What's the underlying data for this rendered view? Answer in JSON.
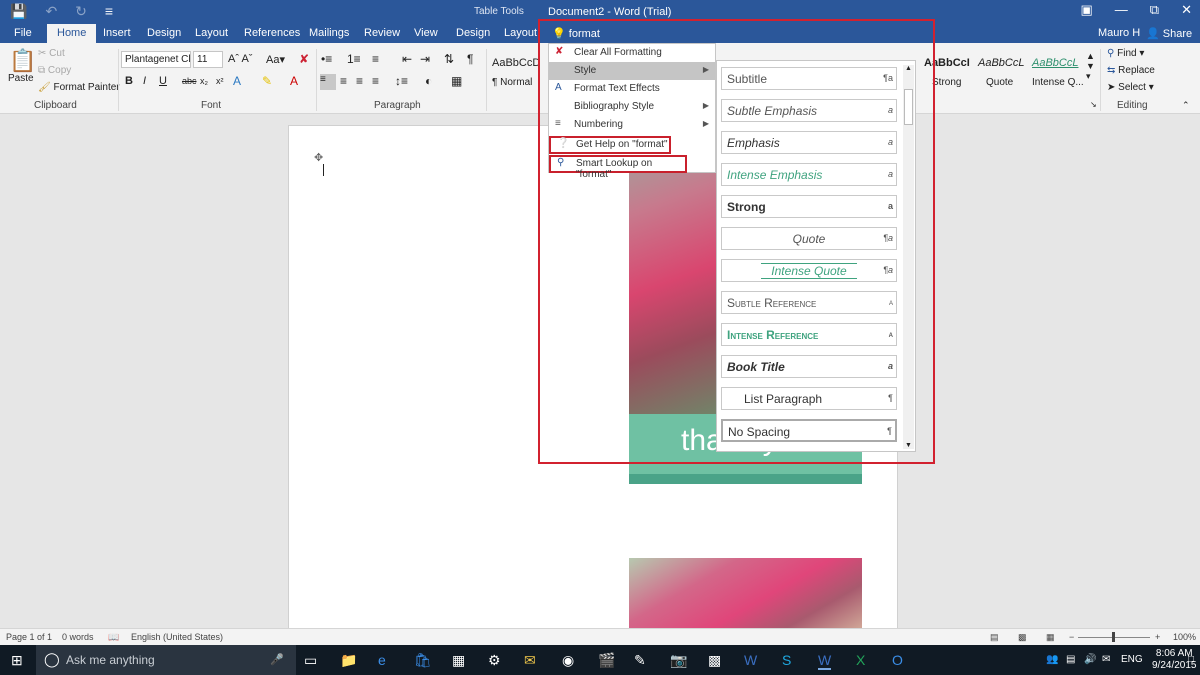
{
  "titlebar": {
    "table_tools": "Table Tools",
    "doc_title": "Document2 - Word (Trial)",
    "qat": [
      "save-icon",
      "undo-icon",
      "redo-icon",
      "customize-icon"
    ]
  },
  "tabs": [
    "File",
    "Home",
    "Insert",
    "Design",
    "Layout",
    "References",
    "Mailings",
    "Review",
    "View",
    "Design",
    "Layout"
  ],
  "user": "Mauro H",
  "share": "Share",
  "tell_me": {
    "value": "format"
  },
  "ribbon": {
    "clipboard": {
      "paste": "Paste",
      "cut": "Cut",
      "copy": "Copy",
      "format_painter": "Format Painter",
      "label": "Clipboard"
    },
    "font": {
      "font_name": "Plantagenet Cl",
      "font_size": "11",
      "label": "Font"
    },
    "paragraph": {
      "label": "Paragraph"
    },
    "styles": [
      {
        "preview": "AaBbCcD",
        "name": "¶ Normal"
      },
      {
        "preview": "AaBbCcI",
        "name": "Strong"
      },
      {
        "preview": "AaBbCcL",
        "name": "Quote"
      },
      {
        "preview": "AaBbCcL",
        "name": "Intense Q..."
      }
    ],
    "editing": {
      "find": "Find",
      "replace": "Replace",
      "select": "Select",
      "label": "Editing"
    }
  },
  "menu": {
    "items": [
      {
        "label": "Clear All Formatting",
        "icon": "eraser-icon"
      },
      {
        "label": "Style",
        "icon": "",
        "submenu": true
      },
      {
        "label": "Format Text Effects",
        "icon": "text-effects-icon"
      },
      {
        "label": "Bibliography Style",
        "icon": "",
        "submenu": true
      },
      {
        "label": "Numbering",
        "icon": "numbering-icon",
        "submenu": true
      },
      {
        "label": "Get Help on \"format\"",
        "icon": "help-icon"
      },
      {
        "label": "Smart Lookup on \"format\"",
        "icon": "smart-lookup-icon"
      }
    ]
  },
  "style_panel": {
    "items": [
      {
        "label": "Subtitle",
        "mark": "¶a"
      },
      {
        "label": "Subtle Emphasis",
        "mark": "a"
      },
      {
        "label": "Emphasis",
        "mark": "a"
      },
      {
        "label": "Intense Emphasis",
        "mark": "a"
      },
      {
        "label": "Strong",
        "mark": "a"
      },
      {
        "label": "Quote",
        "mark": "¶a"
      },
      {
        "label": "Intense Quote",
        "mark": "¶a"
      },
      {
        "label": "Subtle Reference",
        "mark": "a"
      },
      {
        "label": "Intense Reference",
        "mark": "a"
      },
      {
        "label": "Book Title",
        "mark": "a"
      },
      {
        "label": "List Paragraph",
        "mark": "¶"
      },
      {
        "label": "No Spacing",
        "mark": "¶"
      }
    ]
  },
  "document": {
    "thank_you": "thank you"
  },
  "status": {
    "page": "Page 1 of 1",
    "words": "0 words",
    "language": "English (United States)",
    "zoom": "100%"
  },
  "taskbar": {
    "search_placeholder": "Ask me anything",
    "lang": "ENG",
    "time": "8:06 AM",
    "date": "9/24/2015"
  },
  "colors": {
    "accent": "#2b579a",
    "highlight_frame": "#d2212f",
    "teal": "#6fc1a3"
  }
}
